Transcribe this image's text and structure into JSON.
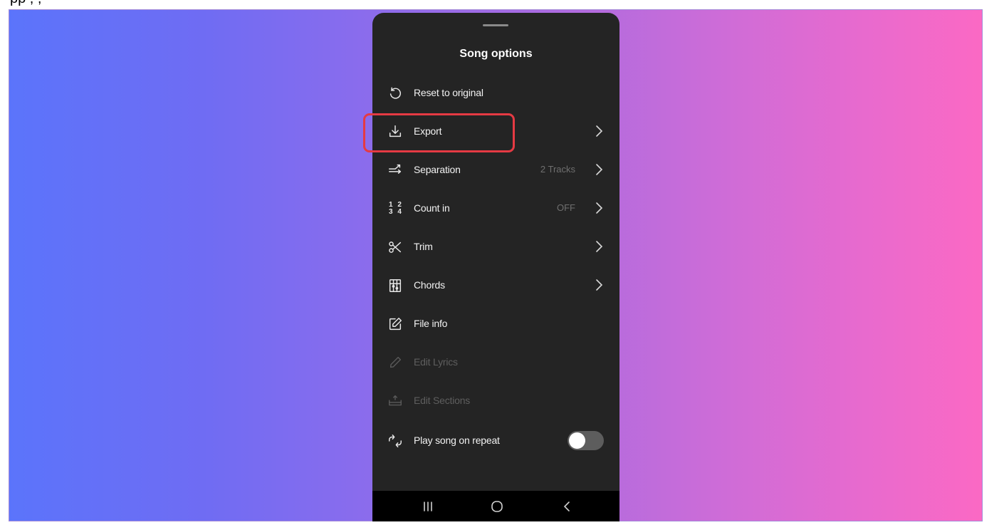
{
  "caption": {
    "cropped_text": "pp , ,"
  },
  "sheet": {
    "title": "Song options",
    "items": [
      {
        "label": "Reset to original"
      },
      {
        "label": "Export"
      },
      {
        "label": "Separation",
        "value": "2 Tracks"
      },
      {
        "label": "Count in",
        "value": "OFF",
        "icon_text_top": "1 2",
        "icon_text_bottom": "3 4"
      },
      {
        "label": "Trim"
      },
      {
        "label": "Chords"
      },
      {
        "label": "File info"
      },
      {
        "label": "Edit Lyrics",
        "disabled": true
      },
      {
        "label": "Edit Sections",
        "disabled": true
      },
      {
        "label": "Play song on repeat",
        "toggle": "off"
      }
    ]
  },
  "icons": {
    "reset": "reset-icon",
    "export": "download-icon",
    "separation": "separation-icon",
    "count_in": "count-in-icon",
    "trim": "scissors-icon",
    "chords": "chord-grid-icon",
    "file_info": "edit-square-icon",
    "edit_lyrics": "pencil-icon",
    "edit_sections": "sections-icon",
    "repeat": "repeat-icon",
    "nav_recents": "recents-icon",
    "nav_home": "home-icon",
    "nav_back": "back-icon"
  },
  "colors": {
    "sheet_background": "#242424",
    "highlight": "#e53a43",
    "gradient_start": "#5b74fb",
    "gradient_end": "#fb69c4"
  }
}
